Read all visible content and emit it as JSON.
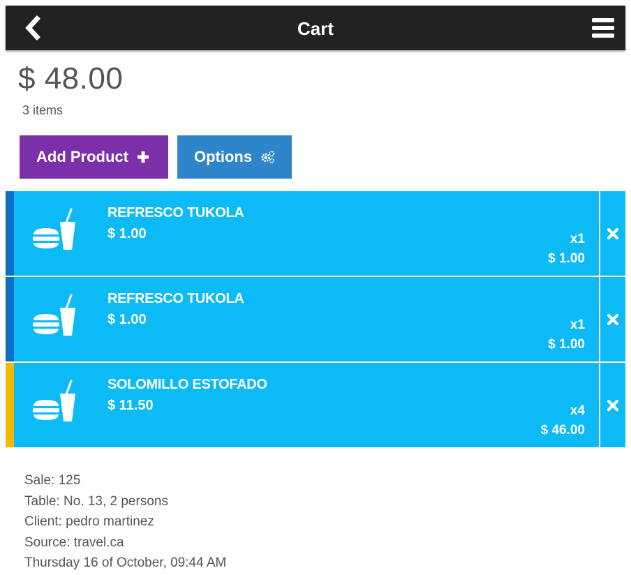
{
  "header": {
    "title": "Cart",
    "back_icon": "chevron-left-icon",
    "menu_icon": "hamburger-menu-icon"
  },
  "summary": {
    "total": "$ 48.00",
    "count": "3 items"
  },
  "actions": {
    "add_label": "Add Product",
    "add_icon": "plus-icon",
    "add_color": "#7b2fa8",
    "options_label": "Options",
    "options_icon": "gears-icon",
    "options_color": "#2f85c9"
  },
  "items": [
    {
      "name": "REFRESCO TUKOLA",
      "price": "$ 1.00",
      "qty": "x1",
      "total": "$ 1.00",
      "stripe_color": "#0a6fc2",
      "icon": "burger-drink-icon"
    },
    {
      "name": "REFRESCO TUKOLA",
      "price": "$ 1.00",
      "qty": "x1",
      "total": "$ 1.00",
      "stripe_color": "#0a6fc2",
      "icon": "burger-drink-icon"
    },
    {
      "name": "SOLOMILLO ESTOFADO",
      "price": "$ 11.50",
      "qty": "x4",
      "total": "$ 46.00",
      "stripe_color": "#f5b800",
      "icon": "burger-drink-icon"
    }
  ],
  "item_color": "#0cbaf6",
  "sale_info": {
    "sale": "Sale: 125",
    "table": "Table: No. 13, 2 persons",
    "client": "Client: pedro martinez",
    "source": "Source: travel.ca",
    "datetime": "Thursday 16 of October, 09:44 AM"
  }
}
